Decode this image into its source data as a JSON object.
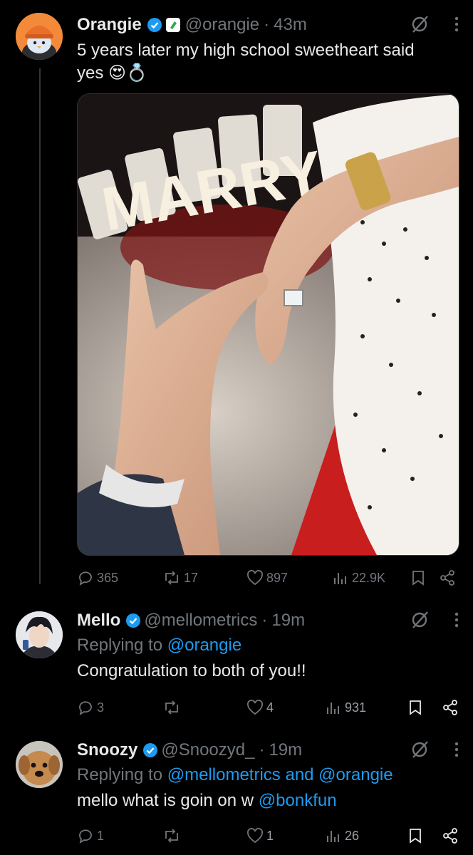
{
  "tweets": [
    {
      "name": "Orangie",
      "handle": "@orangie",
      "time": "43m",
      "text_line1": "5 years later my high school sweetheart said",
      "text_line2": "yes",
      "emojis": "😍💍",
      "stats": {
        "replies": "365",
        "reposts": "17",
        "likes": "897",
        "views": "22.9K"
      }
    },
    {
      "name": "Mello",
      "handle": "@mellometrics",
      "time": "19m",
      "replying_prefix": "Replying to",
      "replying_to": "@orangie",
      "text": "Congratulation to both of you!!",
      "stats": {
        "replies": "3",
        "reposts": "",
        "likes": "4",
        "views": "931"
      }
    },
    {
      "name": "Snoozy",
      "handle": "@Snoozyd_",
      "time": "19m",
      "replying_prefix": "Replying to",
      "replying_to": "@mellometrics and @orangie",
      "text_prefix": "mello what is goin on w",
      "text_link": "@bonkfun",
      "stats": {
        "replies": "1",
        "reposts": "",
        "likes": "1",
        "views": "26"
      }
    }
  ],
  "media_sign": "MARRY",
  "separator": "·",
  "colors": {
    "background": "#000000",
    "text": "#e7e9ea",
    "muted": "#71767b",
    "link": "#1d9bf0",
    "verified": "#1d9bf0"
  }
}
